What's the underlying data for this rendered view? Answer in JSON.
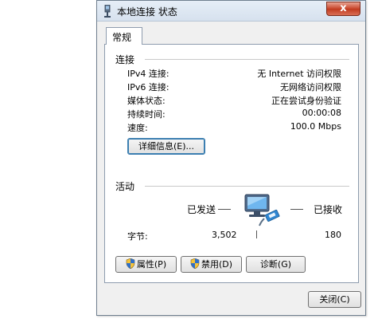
{
  "window": {
    "title": "本地连接 状态",
    "close_label": "x"
  },
  "tab": {
    "label": "常规"
  },
  "connection": {
    "heading": "连接",
    "rows": [
      {
        "label": "IPv4 连接:",
        "value": "无 Internet 访问权限"
      },
      {
        "label": "IPv6 连接:",
        "value": "无网络访问权限"
      },
      {
        "label": "媒体状态:",
        "value": "正在尝试身份验证"
      },
      {
        "label": "持续时间:",
        "value": "00:00:08"
      },
      {
        "label": "速度:",
        "value": "100.0 Mbps"
      }
    ],
    "details_button": "详细信息(E)..."
  },
  "activity": {
    "heading": "活动",
    "sent_label": "已发送",
    "received_label": "已接收",
    "bytes_label": "字节:",
    "bytes_sent": "3,502",
    "bytes_received": "180"
  },
  "buttons": {
    "properties": "属性(P)",
    "disable": "禁用(D)",
    "diagnose": "诊断(G)",
    "close": "关闭(C)"
  },
  "icons": {
    "title": "network-connection-icon",
    "activity": "network-activity-icon",
    "shield": "uac-shield-icon"
  }
}
